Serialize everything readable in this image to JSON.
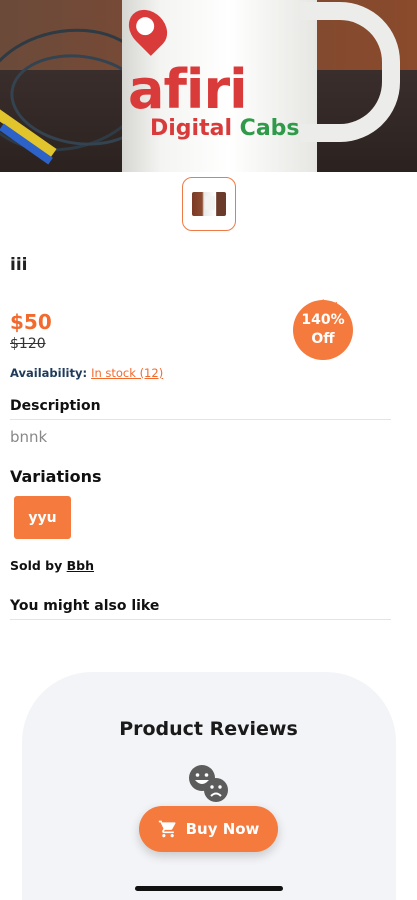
{
  "hero": {
    "image_alt": "Mug with afiri Cabs logo",
    "mug_logo": "afiri",
    "mug_logo_sub": "Cabs",
    "mug_tagline": "Digital"
  },
  "gallery": {
    "thumbnail_alt": "mug thumbnail"
  },
  "product": {
    "title": "iii",
    "price": "$50",
    "old_price": "$120",
    "discount_line1": "140%",
    "discount_line2": "Off",
    "availability_label": "Availability:",
    "availability_value": "In stock (12)"
  },
  "description": {
    "heading": "Description",
    "text": "bnnk"
  },
  "variations": {
    "heading": "Variations",
    "options": [
      "yyu"
    ]
  },
  "seller": {
    "label": "Sold by",
    "name": "Bbh"
  },
  "recommend": {
    "heading": "You might also like"
  },
  "reviews": {
    "title": "Product Reviews",
    "icon": "emoji-faces-icon"
  },
  "cta": {
    "label": "Buy Now",
    "icon": "cart-icon"
  },
  "colors": {
    "accent": "#f47a3d",
    "price": "#f26a2e",
    "availability_label": "#1f3a5a"
  }
}
